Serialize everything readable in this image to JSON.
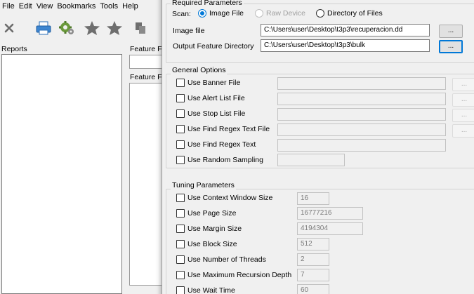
{
  "menu": [
    "File",
    "Edit",
    "View",
    "Bookmarks",
    "Tools",
    "Help"
  ],
  "toolbar": {
    "icons": [
      "close-icon",
      "print-icon",
      "settings-gear-icon",
      "bookmark-star-icon",
      "bookmark-star-add-icon",
      "copy-icon"
    ]
  },
  "panes": {
    "reports_label": "Reports",
    "feature_label_1": "Feature F",
    "feature_label_2": "Feature F"
  },
  "dialog": {
    "required": {
      "title": "Required Parameters",
      "scan_label": "Scan:",
      "scan_options": [
        "Image File",
        "Raw Device",
        "Directory of Files"
      ],
      "scan_selected": "Image File",
      "image_file_label": "Image file",
      "image_file_value": "C:\\Users\\user\\Desktop\\t3p3\\recuperacion.dd",
      "output_dir_label": "Output Feature Directory",
      "output_dir_value": "C:\\Users\\user\\Desktop\\t3p3\\bulk",
      "browse_label": "..."
    },
    "general": {
      "title": "General Options",
      "options": [
        {
          "label": "Use Banner File",
          "checked": false,
          "browse": "..."
        },
        {
          "label": "Use Alert List File",
          "checked": false,
          "browse": "..."
        },
        {
          "label": "Use Stop List File",
          "checked": false,
          "browse": "..."
        },
        {
          "label": "Use Find Regex Text File",
          "checked": false,
          "browse": "..."
        },
        {
          "label": "Use Find Regex Text",
          "checked": false
        },
        {
          "label": "Use Random Sampling",
          "checked": false
        }
      ]
    },
    "tuning": {
      "title": "Tuning Parameters",
      "options": [
        {
          "label": "Use Context Window Size",
          "value": "16",
          "checked": false
        },
        {
          "label": "Use Page Size",
          "value": "16777216",
          "checked": false
        },
        {
          "label": "Use Margin Size",
          "value": "4194304",
          "checked": false
        },
        {
          "label": "Use Block Size",
          "value": "512",
          "checked": false
        },
        {
          "label": "Use Number of Threads",
          "value": "2",
          "checked": false
        },
        {
          "label": "Use Maximum Recursion Depth",
          "value": "7",
          "checked": false
        },
        {
          "label": "Use Wait Time",
          "value": "60",
          "checked": false
        }
      ]
    }
  }
}
